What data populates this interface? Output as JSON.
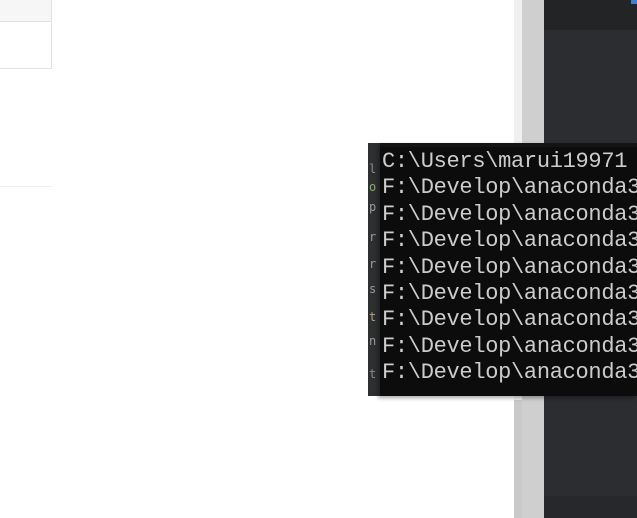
{
  "console": {
    "lines": [
      "C:\\Users\\marui19971",
      "F:\\Develop\\anaconda3",
      "F:\\Develop\\anaconda3",
      "F:\\Develop\\anaconda3",
      "F:\\Develop\\anaconda3",
      "F:\\Develop\\anaconda3",
      "F:\\Develop\\anaconda3",
      "F:\\Develop\\anaconda3",
      "F:\\Develop\\anaconda3"
    ]
  },
  "colors": {
    "console_background": "#0c0c0c",
    "console_text": "#cccccc",
    "editor_background": "#2b2d30",
    "page_background": "#ffffff"
  }
}
